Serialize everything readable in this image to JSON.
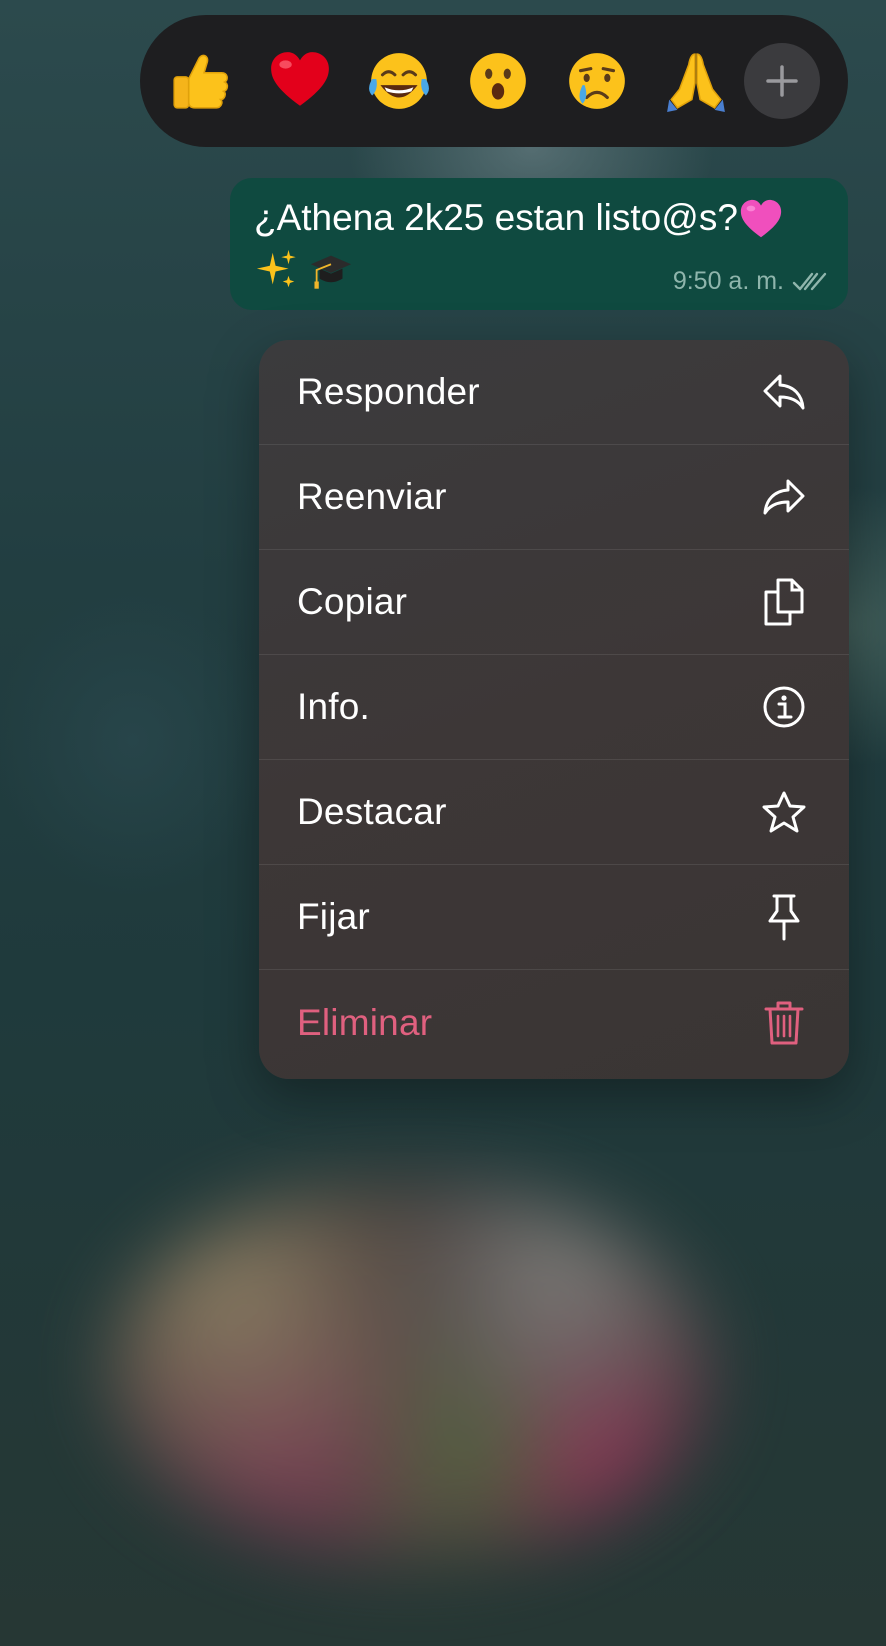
{
  "reactions": {
    "items": [
      {
        "name": "thumbs-up-emoji"
      },
      {
        "name": "red-heart-emoji"
      },
      {
        "name": "tears-of-joy-emoji"
      },
      {
        "name": "surprised-face-emoji"
      },
      {
        "name": "crying-face-emoji"
      },
      {
        "name": "folded-hands-emoji"
      }
    ],
    "more_icon": "plus-icon"
  },
  "message": {
    "text": "¿Athena 2k25 estan listo@s?",
    "emoji_suffix": "pink-heart",
    "second_line_emojis": [
      "sparkles",
      "graduation-cap"
    ],
    "time": "9:50 a. m.",
    "status_icon": "double-check-icon",
    "bubble_color": "#0f4a40"
  },
  "context_menu": {
    "items": [
      {
        "label": "Responder",
        "icon": "reply-icon"
      },
      {
        "label": "Reenviar",
        "icon": "forward-icon"
      },
      {
        "label": "Copiar",
        "icon": "copy-icon"
      },
      {
        "label": "Info.",
        "icon": "info-icon"
      },
      {
        "label": "Destacar",
        "icon": "star-icon"
      },
      {
        "label": "Fijar",
        "icon": "pin-icon"
      },
      {
        "label": "Eliminar",
        "icon": "trash-icon",
        "danger": true
      }
    ],
    "danger_color": "#e0607f"
  }
}
